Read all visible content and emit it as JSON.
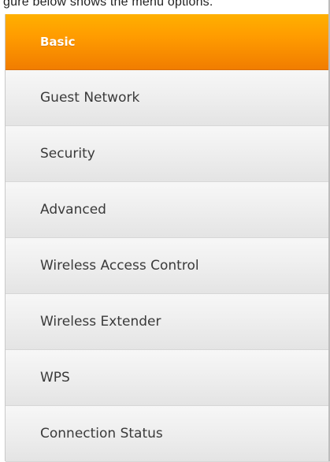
{
  "header": {
    "clipped_text": "gure below shows the menu options."
  },
  "menu": {
    "active_color": "#ff9900",
    "items": [
      {
        "label": "Basic",
        "active": true
      },
      {
        "label": "Guest Network",
        "active": false
      },
      {
        "label": "Security",
        "active": false
      },
      {
        "label": "Advanced",
        "active": false
      },
      {
        "label": "Wireless Access Control",
        "active": false
      },
      {
        "label": "Wireless Extender",
        "active": false
      },
      {
        "label": "WPS",
        "active": false
      },
      {
        "label": "Connection Status",
        "active": false
      }
    ]
  }
}
